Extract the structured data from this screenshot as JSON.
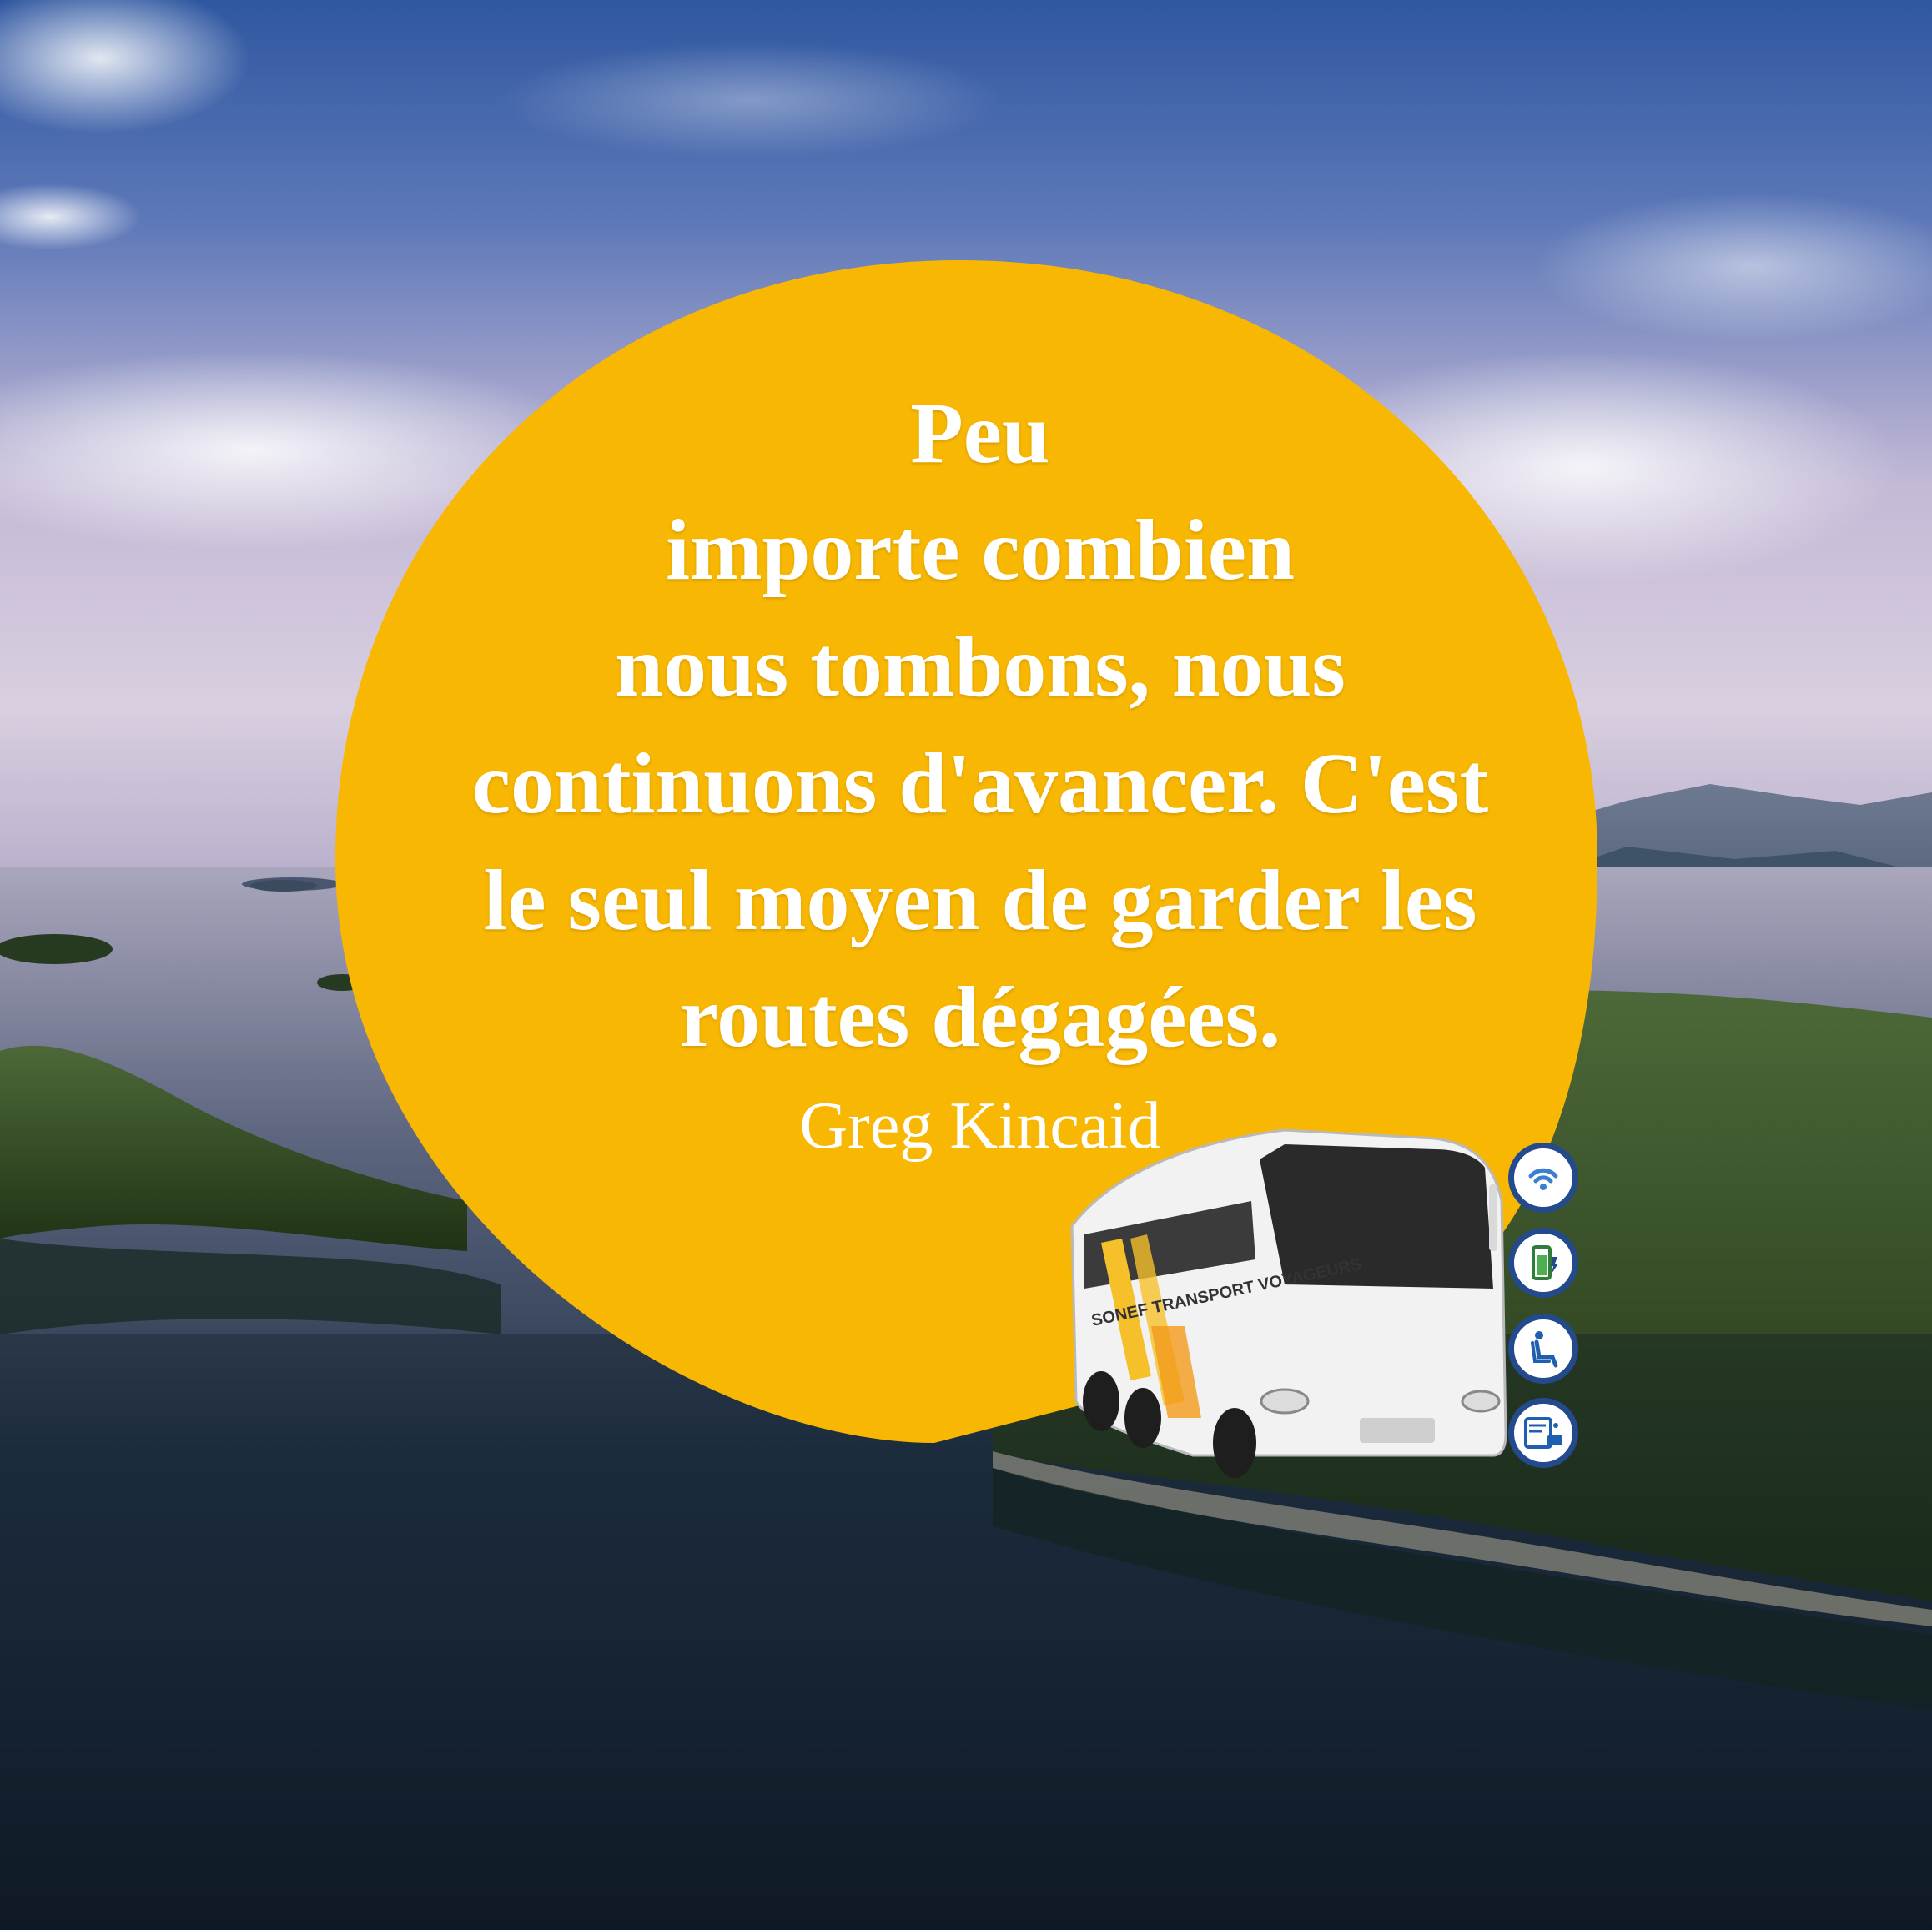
{
  "scene": {
    "description_colors": {
      "bubble": "#f8b703",
      "sky_top": "#3a5fa6",
      "sky_mid": "#b9aed0",
      "water": "#1c2c3c",
      "land": "#2f4a22",
      "badge_ring": "#234a8c"
    }
  },
  "quote": {
    "lines": [
      "Peu",
      "importe combien",
      "nous tombons, nous",
      "continuons d'avancer. C'est",
      "le seul moyen de garder les",
      "routes dégagées."
    ],
    "author": "Greg Kincaid"
  },
  "bus": {
    "side_text": "SONEF TRANSPORT VOYAGEURS"
  },
  "amenities": [
    {
      "icon": "wifi-icon"
    },
    {
      "icon": "charging-icon"
    },
    {
      "icon": "reclining-seat-icon"
    },
    {
      "icon": "entertainment-screen-icon"
    }
  ]
}
